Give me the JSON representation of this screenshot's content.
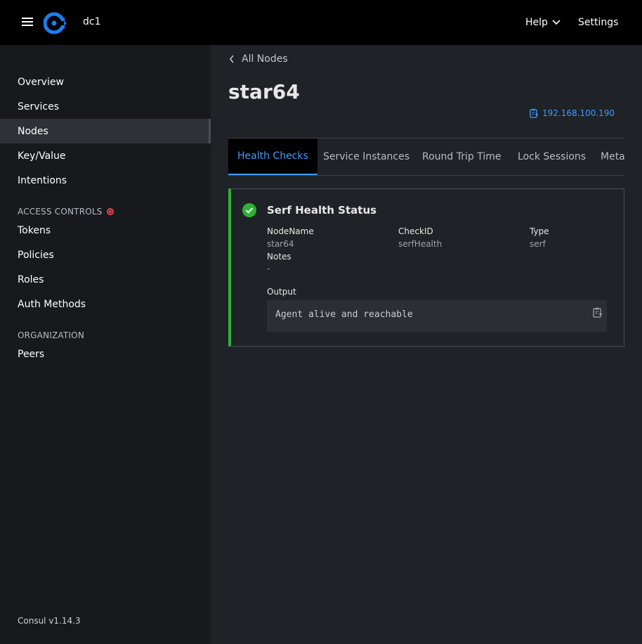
{
  "topbar": {
    "datacenter": "dc1",
    "help_label": "Help",
    "settings_label": "Settings"
  },
  "sidebar": {
    "items": [
      {
        "label": "Overview"
      },
      {
        "label": "Services"
      },
      {
        "label": "Nodes",
        "active": true
      },
      {
        "label": "Key/Value"
      },
      {
        "label": "Intentions"
      }
    ],
    "access_controls_label": "ACCESS CONTROLS",
    "access_items": [
      {
        "label": "Tokens"
      },
      {
        "label": "Policies"
      },
      {
        "label": "Roles"
      },
      {
        "label": "Auth Methods"
      }
    ],
    "organization_label": "ORGANIZATION",
    "organization_items": [
      {
        "label": "Peers"
      }
    ],
    "version": "Consul v1.14.3"
  },
  "main": {
    "breadcrumb": "All Nodes",
    "title": "star64",
    "address": "192.168.100.190",
    "tabs": [
      {
        "label": "Health Checks",
        "active": true
      },
      {
        "label": "Service Instances"
      },
      {
        "label": "Round Trip Time"
      },
      {
        "label": "Lock Sessions"
      },
      {
        "label": "Meta"
      }
    ],
    "check": {
      "title": "Serf Health Status",
      "status": "passing",
      "nodename_label": "NodeName",
      "nodename_value": "star64",
      "checkid_label": "CheckID",
      "checkid_value": "serfHealth",
      "type_label": "Type",
      "type_value": "serf",
      "notes_label": "Notes",
      "notes_value": "-",
      "output_label": "Output",
      "output_value": "Agent alive and reachable"
    }
  },
  "colors": {
    "accent": "#3f9bff",
    "passing": "#2eb039",
    "alert": "#e5484d"
  }
}
